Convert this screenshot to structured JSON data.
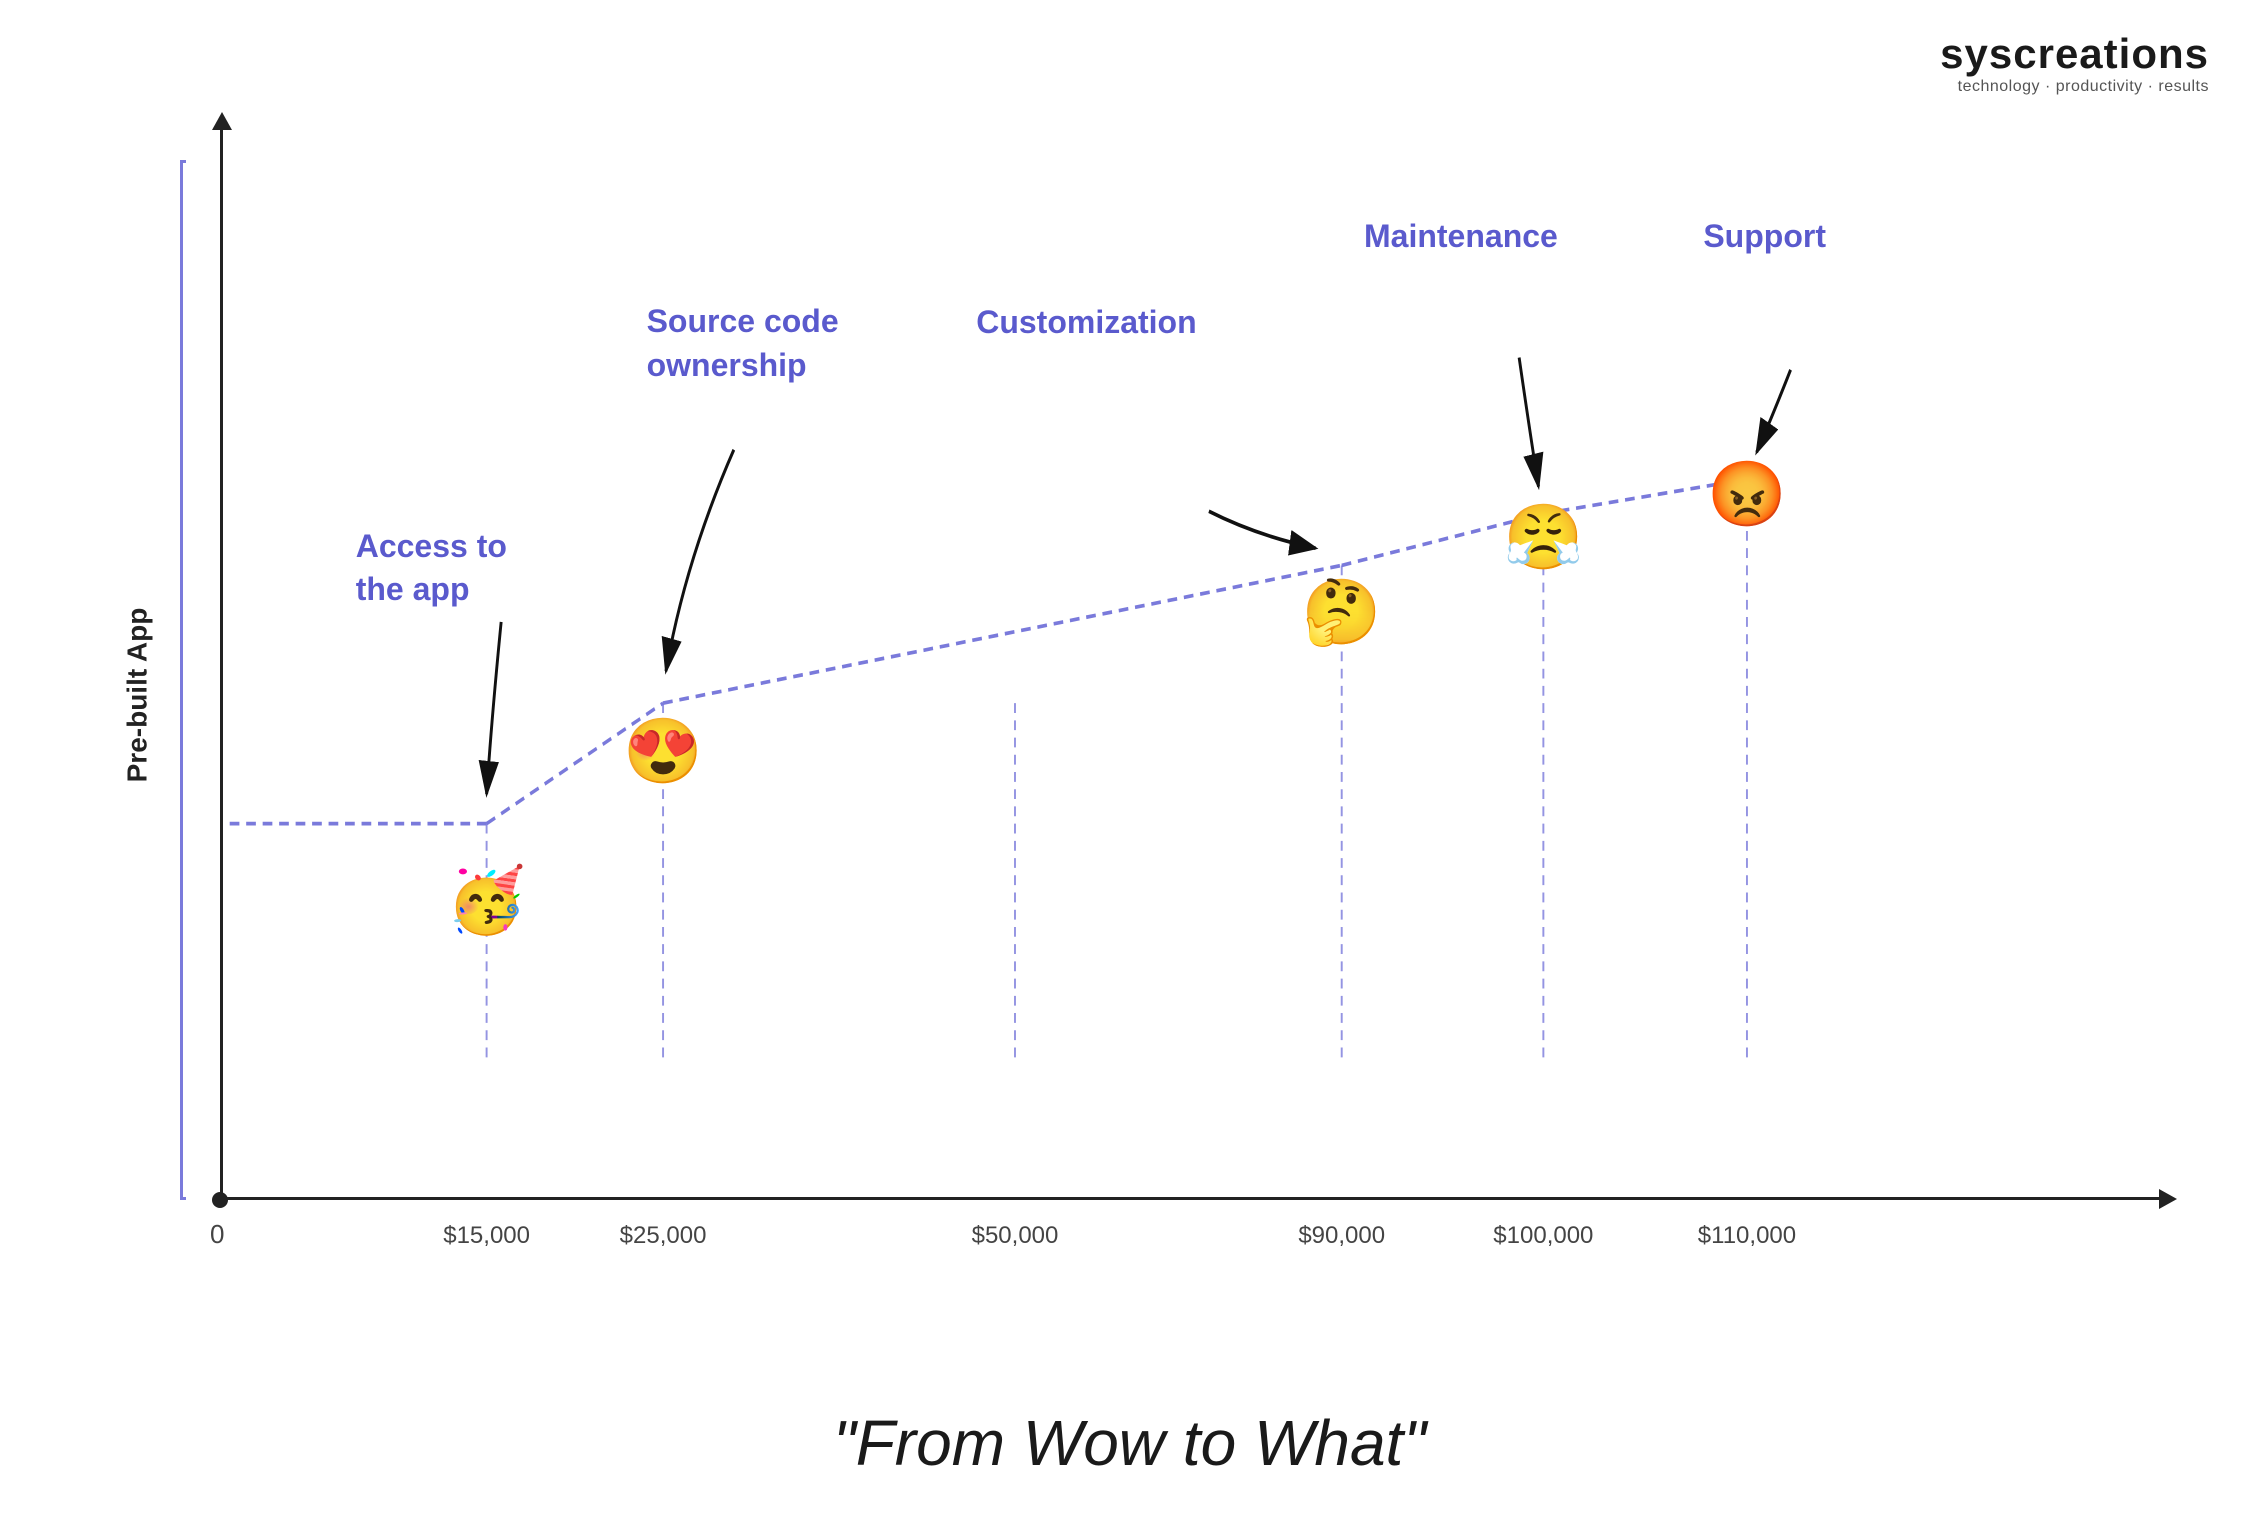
{
  "logo": {
    "name": "syscreations",
    "tagline": "technology · productivity · results"
  },
  "chart": {
    "y_axis_label": "Pre-built App",
    "x_axis_zero": "0",
    "x_ticks": [
      "$15,000",
      "$25,000",
      "$50,000",
      "$90,000",
      "$100,000",
      "$110,000"
    ],
    "annotations": [
      {
        "id": "access",
        "label": "Access to\nthe app",
        "color": "#5a5acd"
      },
      {
        "id": "source",
        "label": "Source code\nownership",
        "color": "#5a5acd"
      },
      {
        "id": "custom",
        "label": "Customization",
        "color": "#5a5acd"
      },
      {
        "id": "maint",
        "label": "Maintenance",
        "color": "#5a5acd"
      },
      {
        "id": "support",
        "label": "Support",
        "color": "#5a5acd"
      }
    ],
    "data_points": [
      {
        "label": "15k",
        "emoji": "🥳",
        "x_pct": 15,
        "y_pct": 28
      },
      {
        "label": "25k",
        "emoji": "😍",
        "x_pct": 25,
        "y_pct": 42
      },
      {
        "label": "90k",
        "emoji": "🤔",
        "x_pct": 62,
        "y_pct": 58
      },
      {
        "label": "100k",
        "emoji": "😤",
        "x_pct": 74,
        "y_pct": 64
      },
      {
        "label": "110k",
        "emoji": "😡",
        "x_pct": 86,
        "y_pct": 68
      }
    ]
  },
  "bottom_label": "\"From Wow to What\""
}
